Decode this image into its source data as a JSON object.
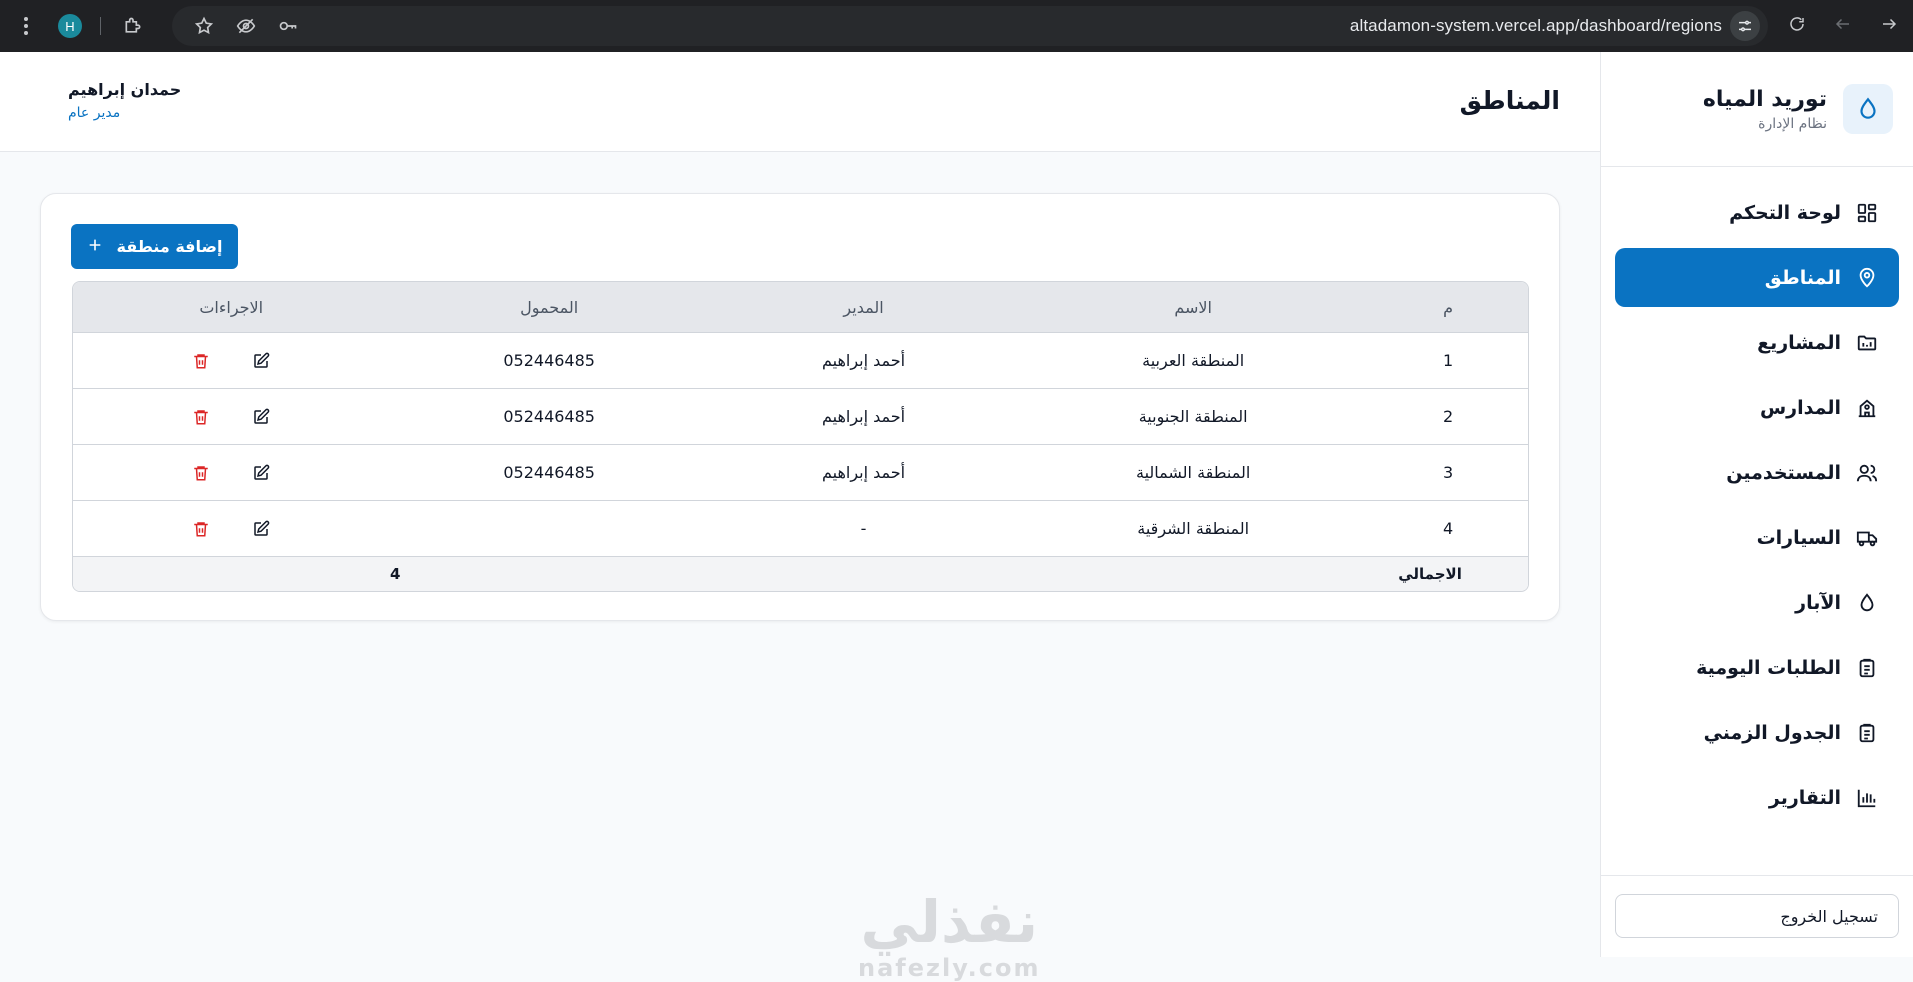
{
  "browser": {
    "profile_initial": "H",
    "url": "altadamon-system.vercel.app/dashboard/regions"
  },
  "brand": {
    "title": "توريد المياه",
    "subtitle": "نظام الإدارة"
  },
  "nav": {
    "items": [
      {
        "label": "لوحة التحكم",
        "icon": "dashboard-icon"
      },
      {
        "label": "المناطق",
        "icon": "map-pin-icon",
        "active": true
      },
      {
        "label": "المشاريع",
        "icon": "folder-icon"
      },
      {
        "label": "المدارس",
        "icon": "school-icon"
      },
      {
        "label": "المستخدمين",
        "icon": "users-icon"
      },
      {
        "label": "السيارات",
        "icon": "truck-icon"
      },
      {
        "label": "الآبار",
        "icon": "droplet-icon"
      },
      {
        "label": "الطلبات اليومية",
        "icon": "clipboard-icon"
      },
      {
        "label": "الجدول الزمني",
        "icon": "clipboard-icon"
      },
      {
        "label": "التقارير",
        "icon": "bar-chart-icon"
      }
    ]
  },
  "logout_label": "تسجيل الخروج",
  "header": {
    "title": "المناطق",
    "user_name": "حمدان إبراهيم",
    "user_role": "مدير عام"
  },
  "add_button_label": "إضافة منطقة",
  "table": {
    "headers": {
      "num": "م",
      "name": "الاسم",
      "manager": "المدير",
      "phone": "المحمول",
      "actions": "الاجراءات"
    },
    "rows": [
      {
        "num": "1",
        "name": "المنطقة العربية",
        "manager": "أحمد إبراهيم",
        "phone": "052446485"
      },
      {
        "num": "2",
        "name": "المنطقة الجنوبية",
        "manager": "أحمد إبراهيم",
        "phone": "052446485"
      },
      {
        "num": "3",
        "name": "المنطقة الشمالية",
        "manager": "أحمد إبراهيم",
        "phone": "052446485"
      },
      {
        "num": "4",
        "name": "المنطقة الشرقية",
        "manager": "-",
        "phone": ""
      }
    ],
    "footer": {
      "label": "الاجمالي",
      "count": "4"
    }
  },
  "watermark": {
    "arabic": "نفذلي",
    "latin": "nafezly.com"
  },
  "colors": {
    "primary": "#0a73c2",
    "delete": "#dc2626",
    "browser_bg": "#202124"
  }
}
